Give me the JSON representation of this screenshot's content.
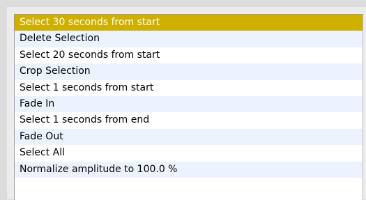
{
  "colors": {
    "selection": "#cfb000",
    "alt_row": "#edf3fe",
    "row": "#ffffff"
  },
  "list": {
    "selected_index": 0,
    "items": [
      "Select 30 seconds from start",
      "Delete Selection",
      "Select 20 seconds from start",
      "Crop Selection",
      "Select 1 seconds from start",
      "Fade In",
      "Select 1 seconds from end",
      "Fade Out",
      "Select All",
      "Normalize amplitude to 100.0 %",
      ""
    ]
  }
}
